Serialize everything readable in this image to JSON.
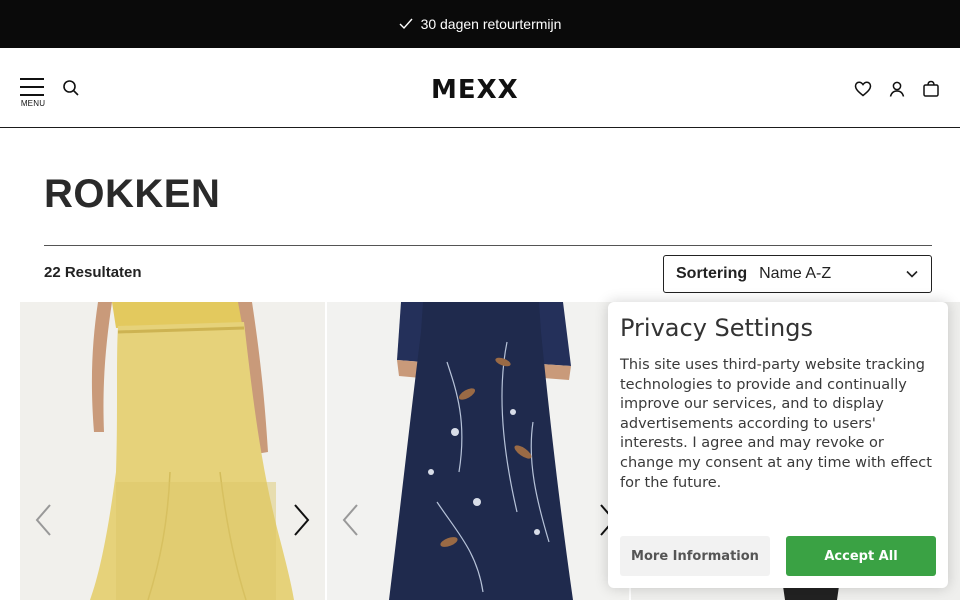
{
  "announcement": {
    "text": "30 dagen retourtermijn",
    "icon": "check-icon"
  },
  "header": {
    "menu_label": "MENU",
    "logo_text": "MEXX",
    "icons": [
      "search-icon",
      "heart-icon",
      "user-icon",
      "bag-icon"
    ]
  },
  "page": {
    "title": "ROKKEN",
    "results": "22 Resultaten",
    "sort": {
      "label": "Sortering",
      "value": "Name A-Z"
    }
  },
  "products": [
    {
      "name": "yellow-knit-maxi-skirt",
      "color": "#e6d27a"
    },
    {
      "name": "navy-floral-satin-skirt",
      "color": "#1f2a4d"
    },
    {
      "name": "third-product",
      "color": "#efefed"
    }
  ],
  "privacy": {
    "title": "Privacy Settings",
    "body": "This site uses third-party website tracking technologies to provide and continually improve our services, and to display advertisements according to users' interests. I agree and may revoke or change my consent at any time with effect for the future.",
    "more_label": "More Information",
    "accept_label": "Accept All",
    "accept_color": "#3aa244"
  }
}
